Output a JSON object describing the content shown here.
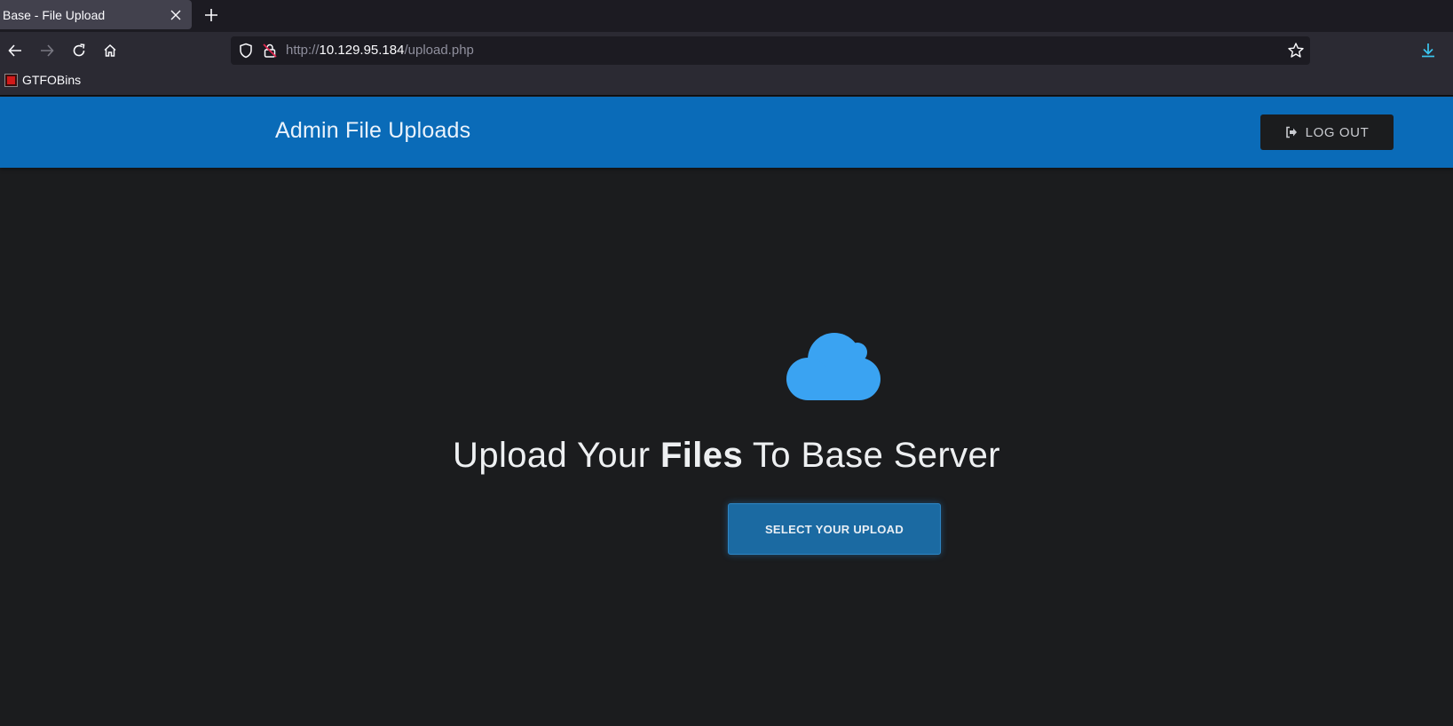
{
  "browser": {
    "tab": {
      "title": "Base - File Upload",
      "close_icon": "close-icon"
    },
    "new_tab_icon": "plus-icon",
    "nav": {
      "back_icon": "arrow-left-icon",
      "forward_icon": "arrow-right-icon",
      "reload_icon": "reload-icon",
      "home_icon": "home-icon"
    },
    "url": {
      "scheme": "http://",
      "host": "10.129.95.184",
      "path": "/upload.php"
    },
    "bookmarks": [
      {
        "label": "GTFOBins"
      }
    ]
  },
  "site": {
    "header": {
      "title": "Admin File Uploads",
      "logout_label": "LOG OUT"
    },
    "main": {
      "headline_pre": "Upload Your ",
      "headline_bold": "Files",
      "headline_post": " To Base Server",
      "upload_label": "SELECT YOUR UPLOAD"
    }
  },
  "colors": {
    "header_bg": "#0a6bb8",
    "page_bg": "#1b1c1e",
    "cloud": "#3aa3f2",
    "upload_button": "#1b6aa2"
  }
}
